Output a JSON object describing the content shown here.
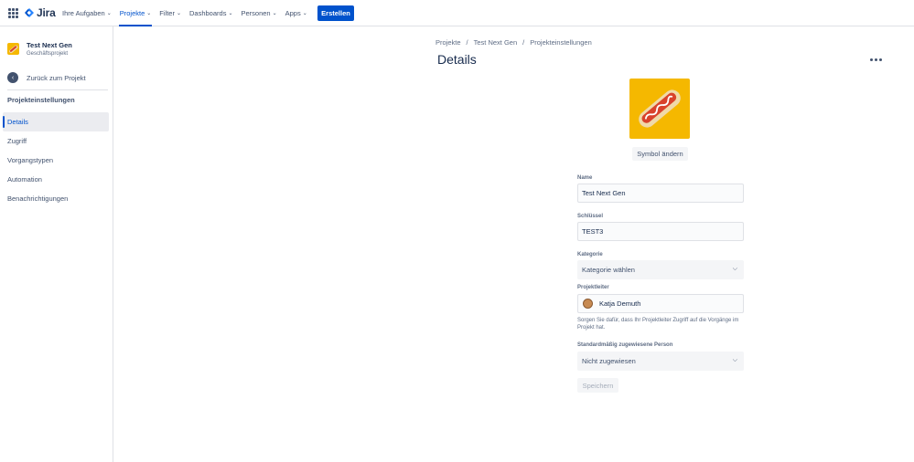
{
  "nav": {
    "logo_text": "Jira",
    "items": [
      {
        "label": "Ihre Aufgaben",
        "active": false
      },
      {
        "label": "Projekte",
        "active": true
      },
      {
        "label": "Filter",
        "active": false
      },
      {
        "label": "Dashboards",
        "active": false
      },
      {
        "label": "Personen",
        "active": false
      },
      {
        "label": "Apps",
        "active": false
      }
    ],
    "create_label": "Erstellen"
  },
  "sidebar": {
    "project_name": "Test Next Gen",
    "project_type": "Geschäftsprojekt",
    "back_label": "Zurück zum Projekt",
    "heading": "Projekteinstellungen",
    "items": [
      {
        "label": "Details",
        "active": true
      },
      {
        "label": "Zugriff",
        "active": false
      },
      {
        "label": "Vorgangstypen",
        "active": false
      },
      {
        "label": "Automation",
        "active": false
      },
      {
        "label": "Benachrichtigungen",
        "active": false
      }
    ]
  },
  "main": {
    "breadcrumb": [
      "Projekte",
      "Test Next Gen",
      "Projekteinstellungen"
    ],
    "title": "Details",
    "change_icon_label": "Symbol ändern",
    "fields": {
      "name_label": "Name",
      "name_value": "Test Next Gen",
      "key_label": "Schlüssel",
      "key_value": "TEST3",
      "category_label": "Kategorie",
      "category_value": "Kategorie wählen",
      "lead_label": "Projektleiter",
      "lead_value": "Katja Demuth",
      "lead_helper": "Sorgen Sie dafür, dass Ihr Projektleiter Zugriff auf die Vorgänge im Projekt hat.",
      "assignee_label": "Standardmäßig zugewiesene Person",
      "assignee_value": "Nicht zugewiesen"
    },
    "save_label": "Speichern"
  },
  "colors": {
    "accent": "#0052cc",
    "project_icon_bg": "#f5b800"
  }
}
